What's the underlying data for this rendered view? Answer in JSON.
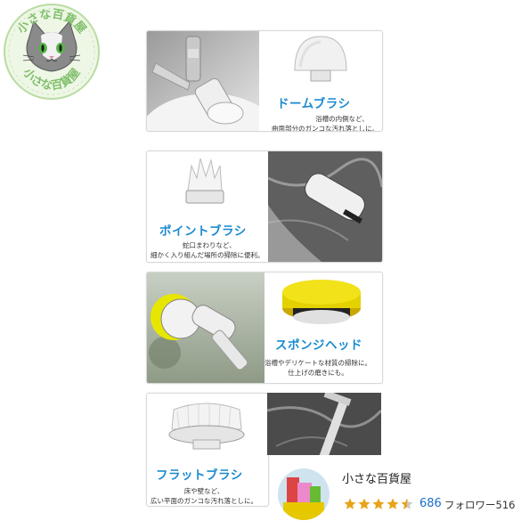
{
  "watermark": {
    "text": "小さな百貨屋"
  },
  "cards": [
    {
      "title": "ドームブラシ",
      "desc_lines": [
        "浴槽の内側など、",
        "曲面部分のガンコな汚れ落としに。"
      ]
    },
    {
      "title": "ポイントブラシ",
      "desc_lines": [
        "蛇口まわりなど、",
        "細かく入り組んだ場所の掃除に便利。"
      ]
    },
    {
      "title": "スポンジヘッド",
      "desc_lines": [
        "浴槽やデリケートな材質の掃除に。",
        "仕上げの磨きにも。"
      ]
    },
    {
      "title": "フラットブラシ",
      "desc_lines": [
        "床や壁など、",
        "広い平面のガンコな汚れ落としに。"
      ]
    }
  ],
  "shop": {
    "name": "小さな百貨屋",
    "rating_count": "686",
    "followers": "フォロワー516",
    "stars_filled": 4.5,
    "star_color": "#e8a317"
  },
  "colors": {
    "title_blue": "#1a8ad0",
    "rating_blue": "#1a6ec6"
  }
}
